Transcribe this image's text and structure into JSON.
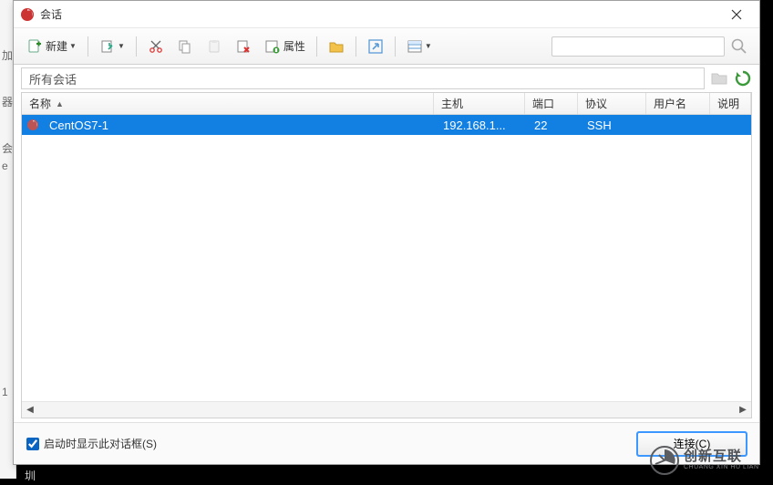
{
  "window": {
    "title": "会话"
  },
  "toolbar": {
    "new_label": "新建",
    "props_label": "属性",
    "search_placeholder": ""
  },
  "pathbar": {
    "value": "所有会话"
  },
  "columns": {
    "name": "名称",
    "host": "主机",
    "port": "端口",
    "protocol": "协议",
    "user": "用户名",
    "desc": "说明"
  },
  "rows": [
    {
      "name": "CentOS7-1",
      "host": "192.168.1...",
      "port": "22",
      "protocol": "SSH",
      "user": "",
      "desc": ""
    }
  ],
  "footer": {
    "show_on_start": "启动时显示此对话框(S)",
    "connect": "连接(C)"
  },
  "watermark": {
    "main": "创新互联",
    "sub": "CHUANG XIN HU LIAN"
  },
  "bg": {
    "a": "加",
    "b": "器",
    "c": "会",
    "d": "e",
    "e": "1",
    "f": "至圳"
  }
}
